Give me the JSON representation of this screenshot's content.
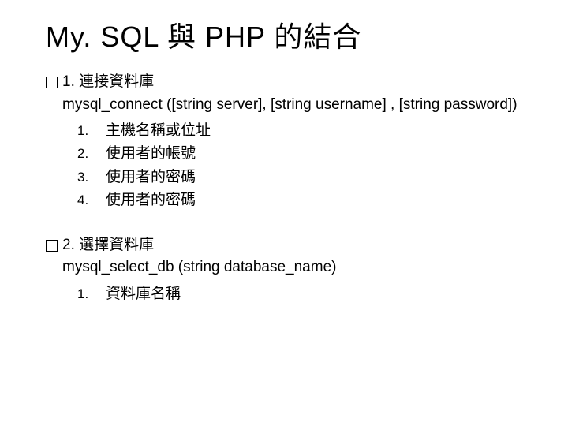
{
  "title": "My. SQL 與 PHP 的結合",
  "sections": [
    {
      "heading": "1. 連接資料庫",
      "code": "mysql_connect ([string server], [string username] , [string password])",
      "items": [
        {
          "num": "1.",
          "text": "主機名稱或位址"
        },
        {
          "num": "2.",
          "text": "使用者的帳號"
        },
        {
          "num": "3.",
          "text": "使用者的密碼"
        },
        {
          "num": "4.",
          "text": "使用者的密碼"
        }
      ]
    },
    {
      "heading": "2. 選擇資料庫",
      "code": "mysql_select_db (string database_name)",
      "items": [
        {
          "num": "1.",
          "text": "資料庫名稱"
        }
      ]
    }
  ]
}
